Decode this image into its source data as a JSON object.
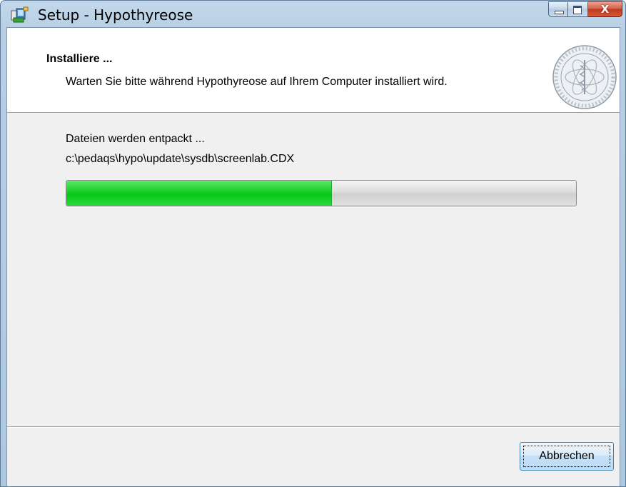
{
  "window": {
    "title": "Setup - Hypothyreose",
    "controls": {
      "minimize_icon": "minimize-icon",
      "maximize_icon": "maximize-icon",
      "close_glyph": "X"
    }
  },
  "header": {
    "title": "Installiere ...",
    "subtitle": "Warten Sie bitte während Hypothyreose auf Ihrem Computer installiert wird.",
    "logo_icon": "university-seal-logo"
  },
  "body": {
    "status": "Dateien werden entpackt ...",
    "current_file": "c:\\pedaqs\\hypo\\update\\sysdb\\screenlab.CDX",
    "progress": 0.52
  },
  "footer": {
    "cancel_label": "Abbrechen"
  },
  "colors": {
    "progress_fill": "#06c716",
    "titlebar": "#b8cfe4",
    "client_bg": "#f0f0f0"
  }
}
